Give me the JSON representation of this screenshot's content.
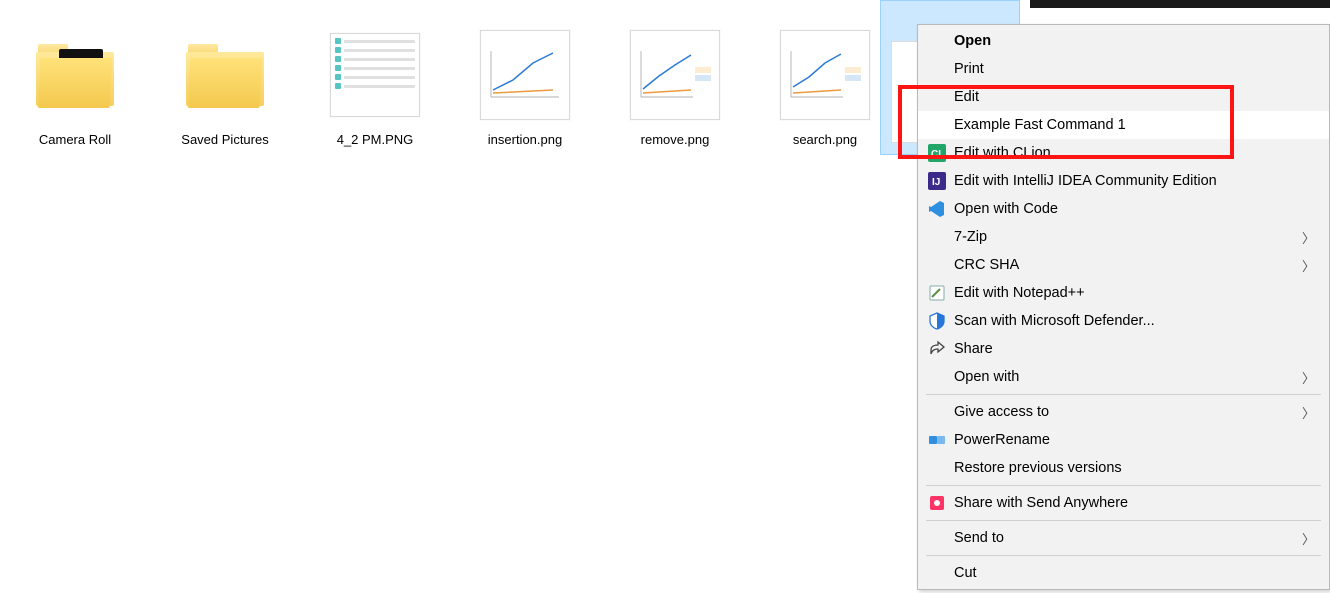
{
  "files": [
    {
      "label": "Camera Roll",
      "kind": "folder-peek"
    },
    {
      "label": "Saved Pictures",
      "kind": "folder"
    },
    {
      "label": "4_2 PM.PNG",
      "kind": "png-list"
    },
    {
      "label": "insertion.png",
      "kind": "png-chart"
    },
    {
      "label": "remove.png",
      "kind": "png-chart"
    },
    {
      "label": "search.png",
      "kind": "png-chart"
    }
  ],
  "menu": {
    "open": "Open",
    "print": "Print",
    "edit": "Edit",
    "example": "Example Fast Command 1",
    "clion": "Edit with CLion",
    "intellij": "Edit with IntelliJ IDEA Community Edition",
    "code": "Open with Code",
    "sevenzip": "7-Zip",
    "crcsha": "CRC SHA",
    "npp": "Edit with Notepad++",
    "defender": "Scan with Microsoft Defender...",
    "share": "Share",
    "openwith": "Open with",
    "giveaccess": "Give access to",
    "powerrename": "PowerRename",
    "restore": "Restore previous versions",
    "sendanywhere": "Share with Send Anywhere",
    "sendto": "Send to",
    "cut": "Cut"
  }
}
